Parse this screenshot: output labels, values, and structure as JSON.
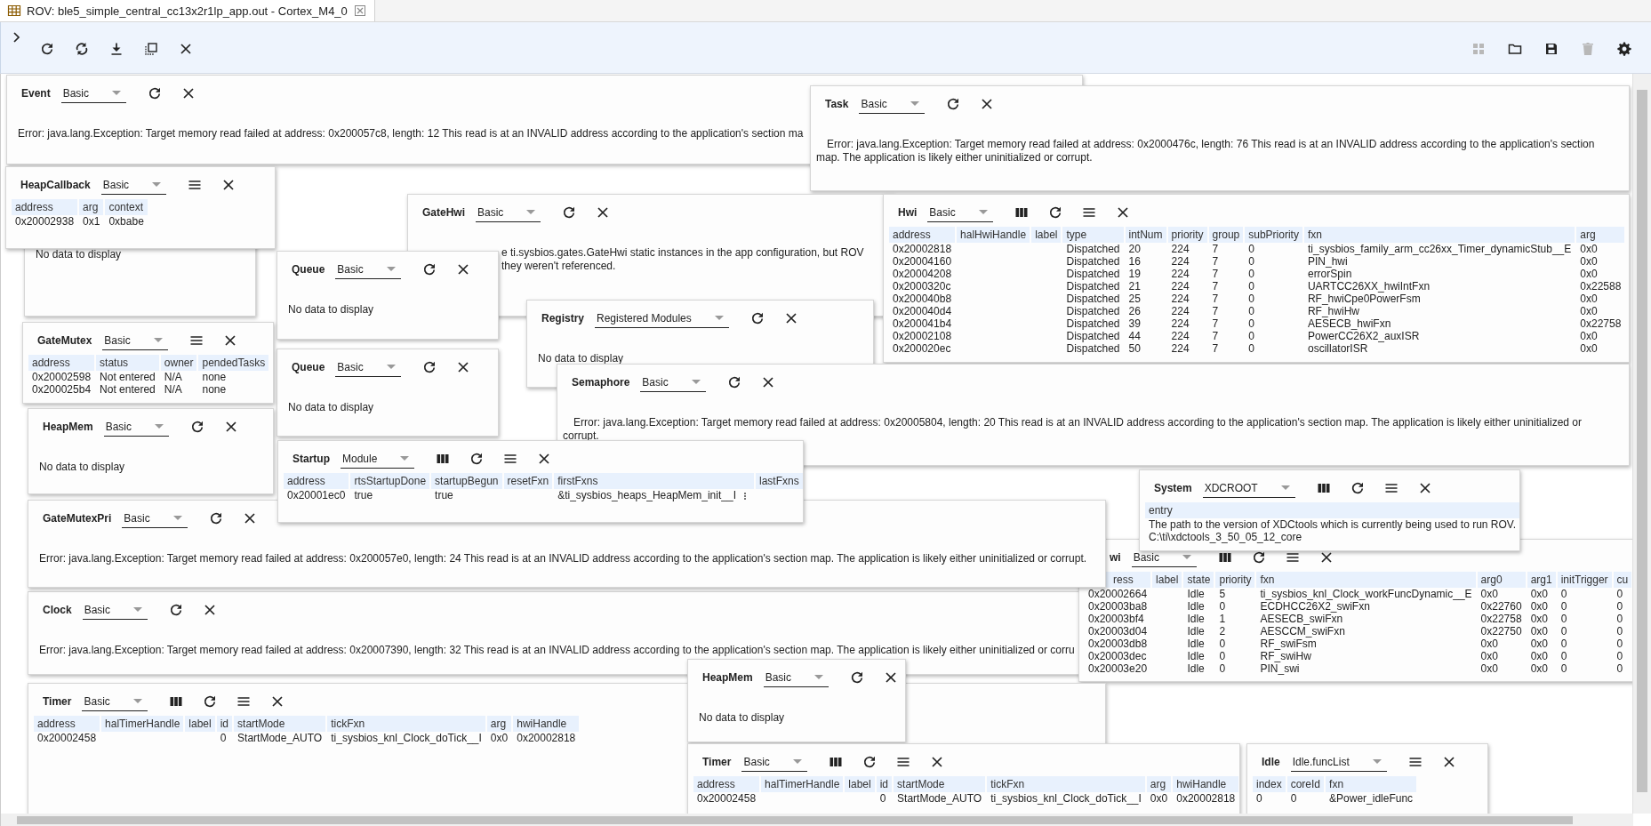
{
  "window": {
    "title": "ROV: ble5_simple_central_cc13x2r1lp_app.out - Cortex_M4_0"
  },
  "toolbar_right": [
    {
      "disabled": true
    },
    {
      "disabled": false
    },
    {
      "disabled": false
    },
    {
      "disabled": true
    },
    {
      "disabled": false
    }
  ],
  "panels": [
    {
      "title": "Event",
      "view": "Basic",
      "message": "Error: java.lang.Exception: Target memory read failed at address: 0x200057c8, length: 12 This read is at an INVALID address according to the application's section ma"
    },
    {
      "title": "Task",
      "view": "Basic",
      "message": "Error: java.lang.Exception: Target memory read failed at address: 0x2000476c, length: 76 This read is at an INVALID address according to the application's section map. The application is likely either uninitialized or corrupt."
    },
    {
      "title": "HeapCallback",
      "view": "Basic",
      "table": {
        "columns": [
          "address",
          "arg",
          "context"
        ],
        "rows": [
          [
            "0x20002938",
            "0x1",
            "0xbabe"
          ]
        ]
      }
    },
    {
      "message": "No data to display"
    },
    {
      "title": "GateHwi",
      "view": "Basic",
      "message_lines": [
        "e ti.sysbios.gates.GateHwi static instances in the app configuration, but ROV",
        "they weren't referenced."
      ]
    },
    {
      "title": "Queue",
      "view": "Basic",
      "message": "No data to display"
    },
    {
      "title": "Queue",
      "view": "Basic",
      "message": "No data to display"
    },
    {
      "title": "GateMutex",
      "view": "Basic",
      "table": {
        "columns": [
          "address",
          "status",
          "owner",
          "pendedTasks"
        ],
        "rows": [
          [
            "0x20002598",
            "Not entered",
            "N/A",
            "none"
          ],
          [
            "0x200025b4",
            "Not entered",
            "N/A",
            "none"
          ]
        ]
      }
    },
    {
      "title": "HeapMem",
      "view": "Basic",
      "message": "No data to display"
    },
    {
      "title": "Registry",
      "view": "Registered Modules",
      "message": "No data to display"
    },
    {
      "title": "Hwi",
      "view": "Basic",
      "table": {
        "columns": [
          "address",
          "halHwiHandle",
          "label",
          "type",
          "intNum",
          "priority",
          "group",
          "subPriority",
          "fxn",
          "arg"
        ],
        "rows": [
          [
            "0x20002818",
            null,
            null,
            "Dispatched",
            "20",
            "224",
            "7",
            "0",
            "ti_sysbios_family_arm_cc26xx_Timer_dynamicStub__E",
            "0x0"
          ],
          [
            "0x20004160",
            null,
            null,
            "Dispatched",
            "16",
            "224",
            "7",
            "0",
            "PIN_hwi",
            "0x0"
          ],
          [
            "0x20004208",
            null,
            null,
            "Dispatched",
            "19",
            "224",
            "7",
            "0",
            "errorSpin",
            "0x0"
          ],
          [
            "0x2000320c",
            null,
            null,
            "Dispatched",
            "21",
            "224",
            "7",
            "0",
            "UARTCC26XX_hwiIntFxn",
            "0x22588"
          ],
          [
            "0x200040b8",
            null,
            null,
            "Dispatched",
            "25",
            "224",
            "7",
            "0",
            "RF_hwiCpe0PowerFsm",
            "0x0"
          ],
          [
            "0x200040d4",
            null,
            null,
            "Dispatched",
            "26",
            "224",
            "7",
            "0",
            "RF_hwiHw",
            "0x0"
          ],
          [
            "0x200041b4",
            null,
            null,
            "Dispatched",
            "39",
            "224",
            "7",
            "0",
            "AESECB_hwiFxn",
            "0x22758"
          ],
          [
            "0x20002108",
            null,
            null,
            "Dispatched",
            "44",
            "224",
            "7",
            "0",
            "PowerCC26X2_auxISR",
            "0x0"
          ],
          [
            "0x200020ec",
            null,
            null,
            "Dispatched",
            "50",
            "224",
            "7",
            "0",
            "oscillatorISR",
            "0x0"
          ]
        ]
      }
    },
    {
      "title": "Semaphore",
      "view": "Basic",
      "message": "Error: java.lang.Exception: Target memory read failed at address: 0x20005804, length: 20 This read is at an INVALID address according to the application's section map. The application is likely either uninitialized or corrupt."
    },
    {
      "title": "Startup",
      "view": "Module",
      "table": {
        "columns": [
          "address",
          "rtsStartupDone",
          "startupBegun",
          "resetFxn",
          "firstFxns",
          "lastFxns"
        ],
        "rows": [
          [
            "0x20001ec0",
            "true",
            "true",
            null,
            {
              "text": "&ti_sysbios_heaps_HeapMem_init__I",
              "overflow_menu": true
            },
            null
          ]
        ]
      }
    },
    {
      "title": "System",
      "view": "XDCROOT",
      "table": {
        "columns": [
          "entry"
        ],
        "rows": [
          [
            "The path to the version of XDCtools which is currently being used to run ROV."
          ],
          [
            "C:\\ti\\xdctools_3_50_05_12_core"
          ]
        ]
      }
    },
    {
      "title": "GateMutexPri",
      "view": "Basic",
      "message": "Error: java.lang.Exception: Target memory read failed at address: 0x200057e0, length: 24 This read is at an INVALID address according to the application's section map. The application is likely either uninitialized or corrupt."
    },
    {
      "title": "wi",
      "view": "Basic",
      "table": {
        "columns": [
          "ress",
          "label",
          "state",
          "priority",
          "fxn",
          "arg0",
          "arg1",
          "initTrigger",
          "cu"
        ],
        "rows": [
          [
            "0x20002664",
            null,
            "Idle",
            "5",
            "ti_sysbios_knl_Clock_workFuncDynamic__E",
            "0x0",
            "0x0",
            "0",
            "0"
          ],
          [
            "0x20003ba8",
            null,
            "Idle",
            "0",
            "ECDHCC26X2_swiFxn",
            "0x22760",
            "0x0",
            "0",
            "0"
          ],
          [
            "0x20003bf4",
            null,
            "Idle",
            "1",
            "AESECB_swiFxn",
            "0x22758",
            "0x0",
            "0",
            "0"
          ],
          [
            "0x20003d04",
            null,
            "Idle",
            "2",
            "AESCCM_swiFxn",
            "0x22750",
            "0x0",
            "0",
            "0"
          ],
          [
            "0x20003db8",
            null,
            "Idle",
            "0",
            "RF_swiFsm",
            "0x0",
            "0x0",
            "0",
            "0"
          ],
          [
            "0x20003dec",
            null,
            "Idle",
            "0",
            "RF_swiHw",
            "0x0",
            "0x0",
            "0",
            "0"
          ],
          [
            "0x20003e20",
            null,
            "Idle",
            "0",
            "PIN_swi",
            "0x0",
            "0x0",
            "0",
            "0"
          ]
        ]
      }
    },
    {
      "title": "Clock",
      "view": "Basic",
      "message": "Error: java.lang.Exception: Target memory read failed at address: 0x20007390, length: 32 This read is at an INVALID address according to the application's section map. The application is likely either uninitialized or corru"
    },
    {
      "title": "HeapMem",
      "view": "Basic",
      "message": "No data to display"
    },
    {
      "title": "Timer",
      "view": "Basic",
      "table": {
        "columns": [
          "address",
          "halTimerHandle",
          "label",
          "id",
          "startMode",
          "tickFxn",
          "arg",
          "hwiHandle"
        ],
        "rows": [
          [
            "0x20002458",
            null,
            null,
            "0",
            "StartMode_AUTO",
            "ti_sysbios_knl_Clock_doTick__I",
            "0x0",
            "0x20002818"
          ]
        ]
      }
    },
    {
      "title": "Timer",
      "view": "Basic",
      "table": {
        "columns": [
          "address",
          "halTimerHandle",
          "label",
          "id",
          "startMode",
          "tickFxn",
          "arg",
          "hwiHandle"
        ],
        "rows": [
          [
            "0x20002458",
            null,
            null,
            "0",
            "StartMode_AUTO",
            "ti_sysbios_knl_Clock_doTick__I",
            "0x0",
            "0x20002818"
          ]
        ]
      }
    },
    {
      "title": "Idle",
      "view": "Idle.funcList",
      "table": {
        "columns": [
          "index",
          "coreId",
          "fxn"
        ],
        "rows": [
          [
            "0",
            "0",
            "&Power_idleFunc"
          ]
        ]
      }
    }
  ]
}
